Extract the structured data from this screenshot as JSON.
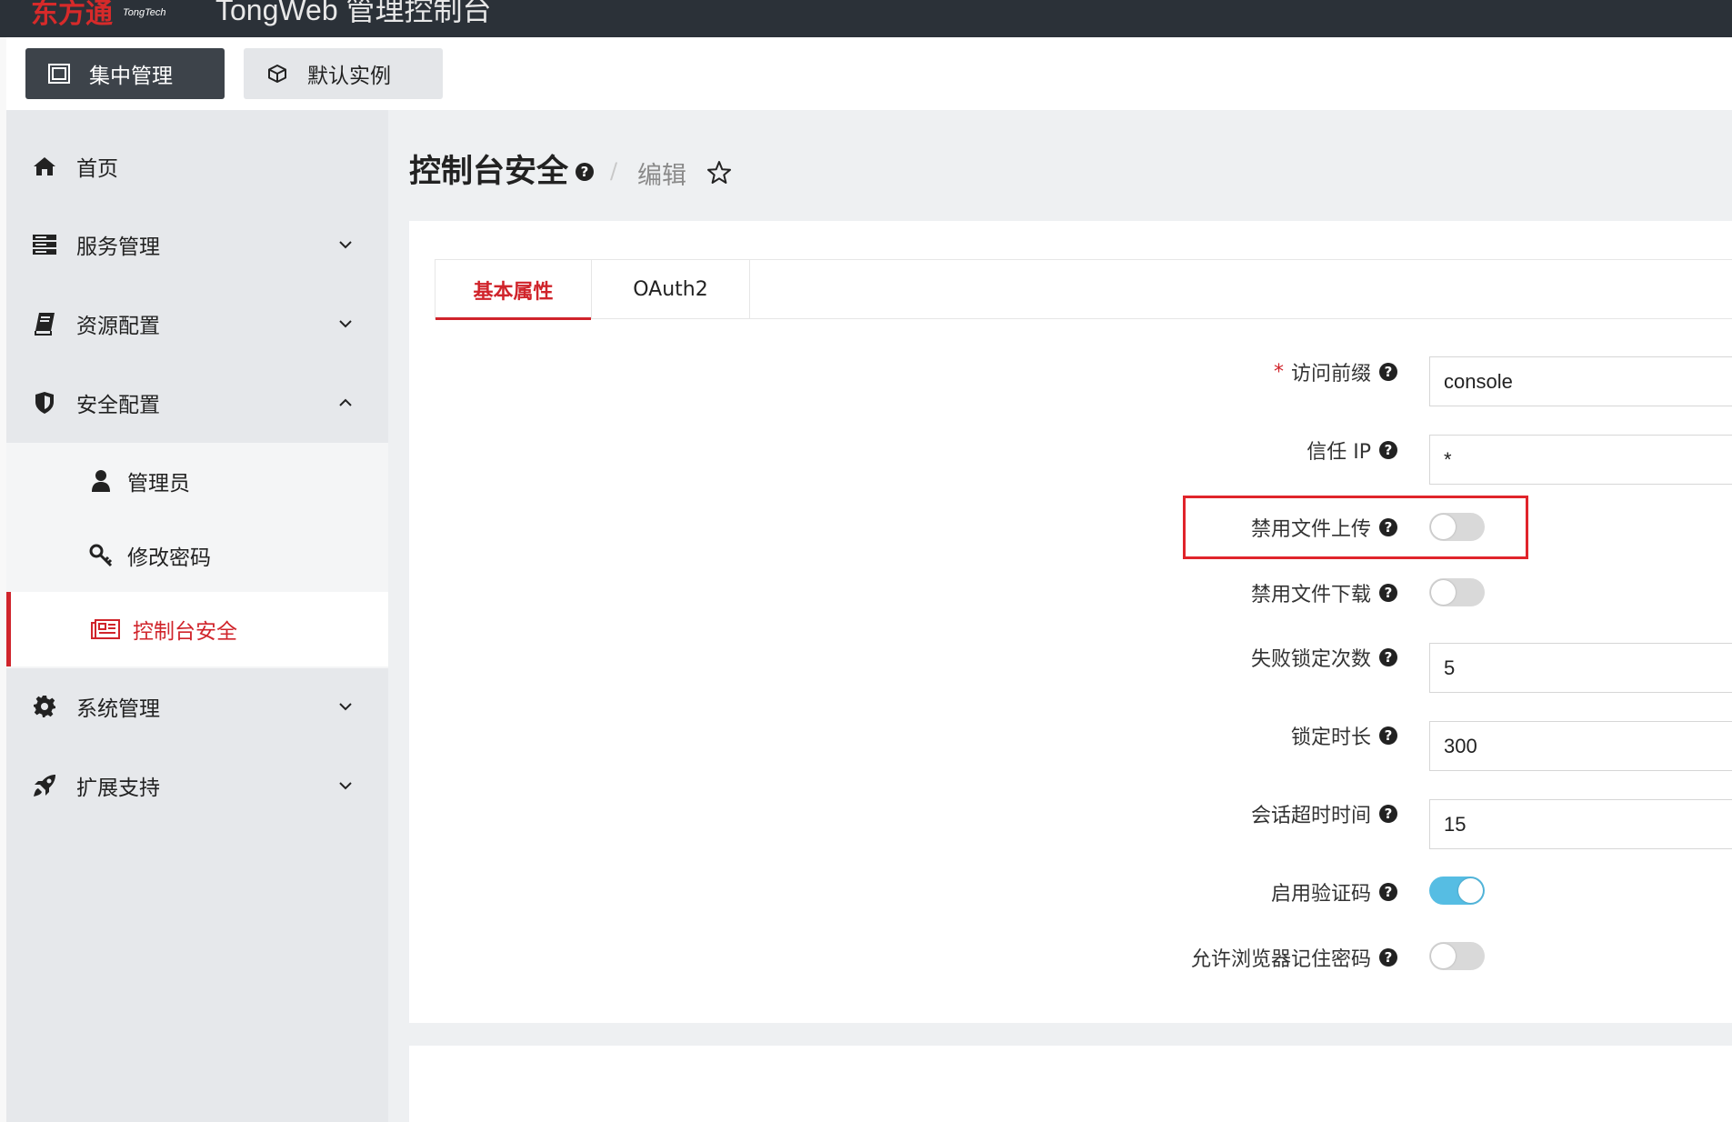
{
  "header": {
    "logo_text": "东方通",
    "logo_sub": "TongTech",
    "app_title": "TongWeb 管理控制台"
  },
  "modes": [
    {
      "label": "集中管理",
      "icon": "frame-icon",
      "active": true
    },
    {
      "label": "默认实例",
      "icon": "cube-icon",
      "active": false
    }
  ],
  "sidebar": {
    "items": [
      {
        "label": "首页",
        "icon": "home-icon"
      },
      {
        "label": "服务管理",
        "icon": "server-icon"
      },
      {
        "label": "资源配置",
        "icon": "book-icon"
      },
      {
        "label": "安全配置",
        "icon": "shield-icon",
        "expanded": true
      },
      {
        "label": "系统管理",
        "icon": "gear-icon"
      },
      {
        "label": "扩展支持",
        "icon": "rocket-icon"
      }
    ],
    "sub_items": [
      {
        "label": "管理员",
        "icon": "user-icon"
      },
      {
        "label": "修改密码",
        "icon": "key-icon"
      },
      {
        "label": "控制台安全",
        "icon": "newspaper-icon",
        "active": true
      }
    ]
  },
  "breadcrumb": {
    "title": "控制台安全",
    "separator": "/",
    "current": "编辑"
  },
  "tabs": [
    {
      "label": "基本属性",
      "active": true
    },
    {
      "label": "OAuth2",
      "active": false
    }
  ],
  "form": {
    "prefix": {
      "label": "访问前缀",
      "required_mark": "*",
      "value": "console"
    },
    "trust_ip": {
      "label": "信任 IP",
      "value": "*"
    },
    "disable_upload": {
      "label": "禁用文件上传",
      "enabled": false
    },
    "disable_download": {
      "label": "禁用文件下载",
      "enabled": false
    },
    "lock_count": {
      "label": "失败锁定次数",
      "value": "5"
    },
    "lock_duration": {
      "label": "锁定时长",
      "value": "300"
    },
    "session_timeout": {
      "label": "会话超时时间",
      "value": "15"
    },
    "captcha": {
      "label": "启用验证码",
      "enabled": true
    },
    "remember_pwd": {
      "label": "允许浏览器记住密码",
      "enabled": false
    }
  },
  "colors": {
    "accent": "#d0242b",
    "header_bg": "#2b3138",
    "toggle_on": "#56bde3"
  }
}
